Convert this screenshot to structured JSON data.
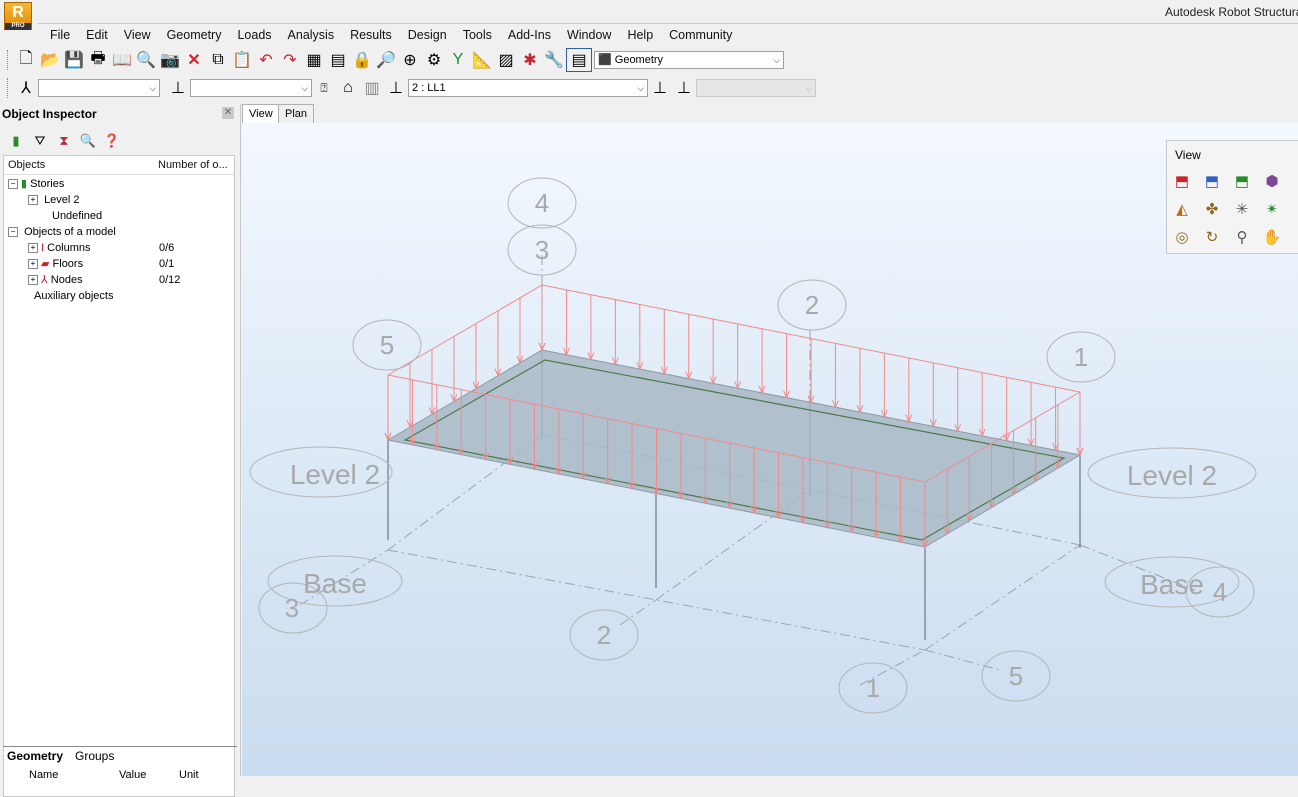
{
  "app": {
    "logo_letter": "R",
    "logo_sub": "PRO",
    "title": "Autodesk Robot Structural Analysis"
  },
  "menu": [
    "File",
    "Edit",
    "View",
    "Geometry",
    "Loads",
    "Analysis",
    "Results",
    "Design",
    "Tools",
    "Add-Ins",
    "Window",
    "Help",
    "Community"
  ],
  "toolbar1": {
    "layout_select": "Geometry"
  },
  "toolbar2": {
    "bar_section_select": "",
    "label_select": "",
    "load_case_select": "2 : LL1",
    "disabled_select": ""
  },
  "inspector": {
    "title": "Object Inspector",
    "col_objects": "Objects",
    "col_number": "Number of o...",
    "tree": [
      {
        "label": "Stories",
        "value": ""
      },
      {
        "label": "Level 2",
        "value": ""
      },
      {
        "label": "Undefined",
        "value": ""
      },
      {
        "label": "Objects of a model",
        "value": ""
      },
      {
        "label": "Columns",
        "value": "0/6"
      },
      {
        "label": "Floors",
        "value": "0/1"
      },
      {
        "label": "Nodes",
        "value": "0/12"
      },
      {
        "label": "Auxiliary objects",
        "value": ""
      }
    ],
    "tab_geometry": "Geometry",
    "tab_groups": "Groups",
    "prop_cols": [
      "Name",
      "Value",
      "Unit"
    ]
  },
  "view_tabs": [
    "View",
    "Plan"
  ],
  "view_palette": {
    "title": "View"
  },
  "model": {
    "grid_labels_top": [
      "4",
      "3",
      "2",
      "5",
      "1"
    ],
    "grid_labels_bottom": [
      "3",
      "2",
      "1",
      "5",
      "4"
    ],
    "story_labels": [
      "Level 2",
      "Level 2",
      "Base",
      "Base"
    ],
    "colors": {
      "load": "#f08a8a",
      "slab": "#9fb0bf",
      "slab_edge": "#4a7a4a",
      "grid_label": "#a9a9a9",
      "column": "#6d7a80"
    }
  }
}
